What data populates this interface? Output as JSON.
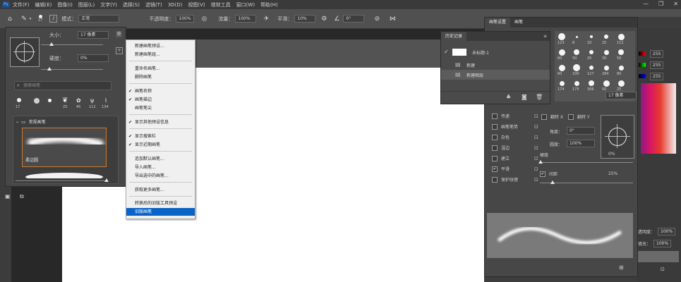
{
  "menubar": {
    "items": [
      "文件(F)",
      "编辑(E)",
      "图像(I)",
      "图层(L)",
      "文字(Y)",
      "选择(S)",
      "滤镜(T)",
      "3D(D)",
      "视图(V)",
      "增效工具",
      "窗口(W)",
      "帮助(H)"
    ],
    "window_controls": [
      "—",
      "❐",
      "✕"
    ]
  },
  "options_bar": {
    "brush_size": "17",
    "mode_label": "模式：",
    "mode_value": "正常",
    "opacity_label": "不透明度：",
    "opacity_value": "100%",
    "flow_label": "流量：",
    "flow_value": "100%",
    "smoothing_label": "平滑：",
    "smoothing_value": "10%",
    "angle_value": "0°"
  },
  "brush_picker": {
    "size_label": "大小：",
    "size_value": "17 像素",
    "hardness_label": "硬度：",
    "hardness_value": "0%",
    "search_placeholder": "搜索画笔",
    "tip_sizes": [
      "17",
      "45",
      "25",
      "45",
      "112",
      "134"
    ],
    "folder_name": "常规画笔",
    "selected_brush": "柔边圆"
  },
  "dropdown_menu": {
    "items": [
      {
        "label": "新建画笔预设...",
        "checked": false,
        "selected": false
      },
      {
        "label": "新建画笔组...",
        "checked": false,
        "selected": false
      },
      {
        "label": "重命名画笔...",
        "checked": false,
        "selected": false
      },
      {
        "label": "删除画笔",
        "checked": false,
        "selected": false
      },
      {
        "label": "画笔名称",
        "checked": true,
        "selected": false
      },
      {
        "label": "画笔描边",
        "checked": true,
        "selected": false
      },
      {
        "label": "画笔笔尖",
        "checked": false,
        "selected": false
      },
      {
        "label": "显示其他预设信息",
        "checked": true,
        "selected": false
      },
      {
        "label": "显示搜索栏",
        "checked": true,
        "selected": false
      },
      {
        "label": "显示近期画笔",
        "checked": true,
        "selected": false
      },
      {
        "label": "追加默认画笔...",
        "checked": false,
        "selected": false
      },
      {
        "label": "导入画笔...",
        "checked": false,
        "selected": false
      },
      {
        "label": "导出选中的画笔...",
        "checked": false,
        "selected": false
      },
      {
        "label": "获取更多画笔...",
        "checked": false,
        "selected": false
      },
      {
        "label": "转换后的旧版工具预设",
        "checked": false,
        "selected": false
      },
      {
        "label": "旧版画笔",
        "checked": false,
        "selected": true
      }
    ]
  },
  "history_panel": {
    "tab": "历史记录",
    "snapshot": "未标题-1",
    "steps": [
      "新建",
      "新建图层"
    ]
  },
  "brush_settings": {
    "tabs": [
      "画笔设置",
      "画笔"
    ],
    "options": [
      {
        "label": "传递",
        "checked": false
      },
      {
        "label": "画笔笔势",
        "checked": false
      },
      {
        "label": "杂色",
        "checked": false
      },
      {
        "label": "湿边",
        "checked": false
      },
      {
        "label": "建立",
        "checked": false
      },
      {
        "label": "平滑",
        "checked": true
      },
      {
        "label": "保护纹理",
        "checked": false
      }
    ],
    "flip_x": "翻转 X",
    "flip_y": "翻转 Y",
    "angle_label": "角度：",
    "angle_value": "0°",
    "roundness_label": "圆度：",
    "roundness_value": "100%",
    "hardness_label": "硬度",
    "hardness_value": "0%",
    "spacing_label": "间距",
    "spacing_value": "25%",
    "spacing_checked": true,
    "size_value": "17 像素",
    "grid_numbers": [
      "123",
      "8",
      "10",
      "25",
      "112",
      "60",
      "50",
      "25",
      "30",
      "50",
      "60",
      "100",
      "127",
      "284",
      "80",
      "174",
      "175",
      "306",
      "50",
      "25"
    ]
  },
  "right_strip": {
    "values": [
      "255",
      "255",
      "255"
    ],
    "opacity_label": "透明度：",
    "opacity_value": "100%",
    "fill_label": "填充：",
    "fill_value": "100%"
  }
}
